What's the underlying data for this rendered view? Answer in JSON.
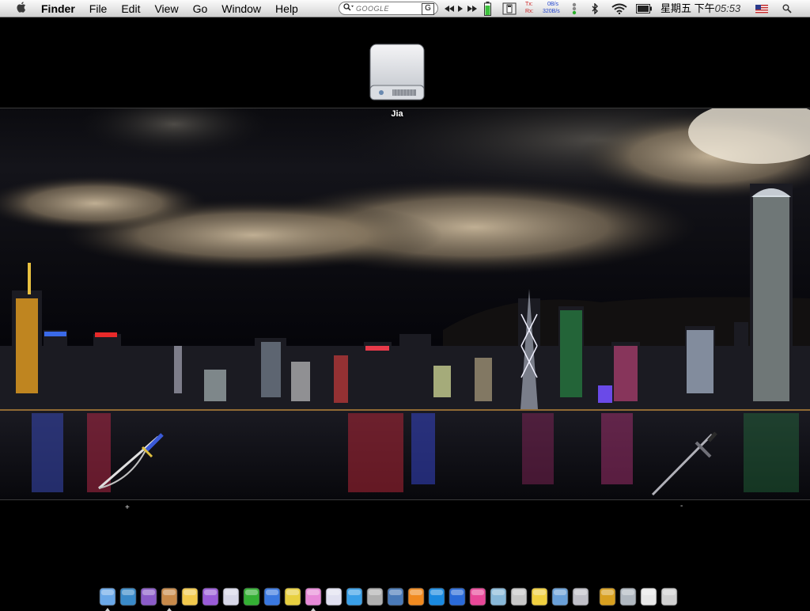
{
  "menubar": {
    "apple": "",
    "app_name": "Finder",
    "items": [
      "File",
      "Edit",
      "View",
      "Go",
      "Window",
      "Help"
    ]
  },
  "search": {
    "placeholder": "GOOGLE",
    "engine_button": "G"
  },
  "network": {
    "tx_label": "Tx:",
    "rx_label": "Rx:",
    "tx_rate": "0B/s",
    "rx_rate": "320B/s"
  },
  "clock": {
    "day": "星期五 下午",
    "time": "05:53"
  },
  "desktop": {
    "drive_label": "Jia",
    "plus_label": "+",
    "minus_label": "-"
  },
  "colors": {
    "menubar_top": "#fbfbfb",
    "menubar_bottom": "#cfcfcf",
    "battery_green": "#3cc13c",
    "net_tx": "#cc2222",
    "net_rx": "#2244cc"
  },
  "dock": {
    "items": [
      {
        "name": "finder-icon",
        "color": "#6aa8e8",
        "running": true
      },
      {
        "name": "spiral-app-icon",
        "color": "#3a8ac8",
        "running": false
      },
      {
        "name": "purple-shield-icon",
        "color": "#8b5cc8",
        "running": false
      },
      {
        "name": "photo-frame-icon",
        "color": "#c88a4a",
        "running": true
      },
      {
        "name": "penguin-icon",
        "color": "#f2c94c",
        "running": false
      },
      {
        "name": "purple-e-icon",
        "color": "#9a5cd8",
        "running": false
      },
      {
        "name": "safari-compass-icon",
        "color": "#d8d8e8",
        "running": false
      },
      {
        "name": "green-globe-icon",
        "color": "#34b034",
        "running": false
      },
      {
        "name": "video-chat-icon",
        "color": "#3a78e0",
        "running": false
      },
      {
        "name": "yellow-figure-icon",
        "color": "#e8d040",
        "running": false
      },
      {
        "name": "pink-ipod-icon",
        "color": "#e88ad8",
        "running": true
      },
      {
        "name": "messenger-icon",
        "color": "#e0e0f0",
        "running": false
      },
      {
        "name": "blue-swirl-icon",
        "color": "#3aa0e8",
        "running": false
      },
      {
        "name": "gray-device-icon",
        "color": "#b0b0b0",
        "running": false
      },
      {
        "name": "preview-icon",
        "color": "#4a7ab8",
        "running": false
      },
      {
        "name": "vlc-cone-icon",
        "color": "#f08a20",
        "running": false
      },
      {
        "name": "blue-q-icon",
        "color": "#1a8ae0",
        "running": false
      },
      {
        "name": "blue-w-icon",
        "color": "#2a6ad8",
        "running": false
      },
      {
        "name": "pink-flower-icon",
        "color": "#e84898",
        "running": false
      },
      {
        "name": "feather-pen-icon",
        "color": "#88b8d8",
        "running": false
      },
      {
        "name": "printer-icon",
        "color": "#c8c8c8",
        "running": false
      },
      {
        "name": "sticky-notes-icon",
        "color": "#f0d040",
        "running": false
      },
      {
        "name": "iphoto-icon",
        "color": "#6aa0d8",
        "running": false
      },
      {
        "name": "disk-utility-icon",
        "color": "#c0c0c8",
        "running": false
      },
      {
        "name": "golden-sword-icon",
        "color": "#d8a020",
        "running": false
      },
      {
        "name": "katana-icon",
        "color": "#b0b8c0",
        "running": false
      },
      {
        "name": "documents-stack-icon",
        "color": "#e8e8e8",
        "running": false
      },
      {
        "name": "trash-icon",
        "color": "#d0d0d0",
        "running": false
      }
    ]
  }
}
